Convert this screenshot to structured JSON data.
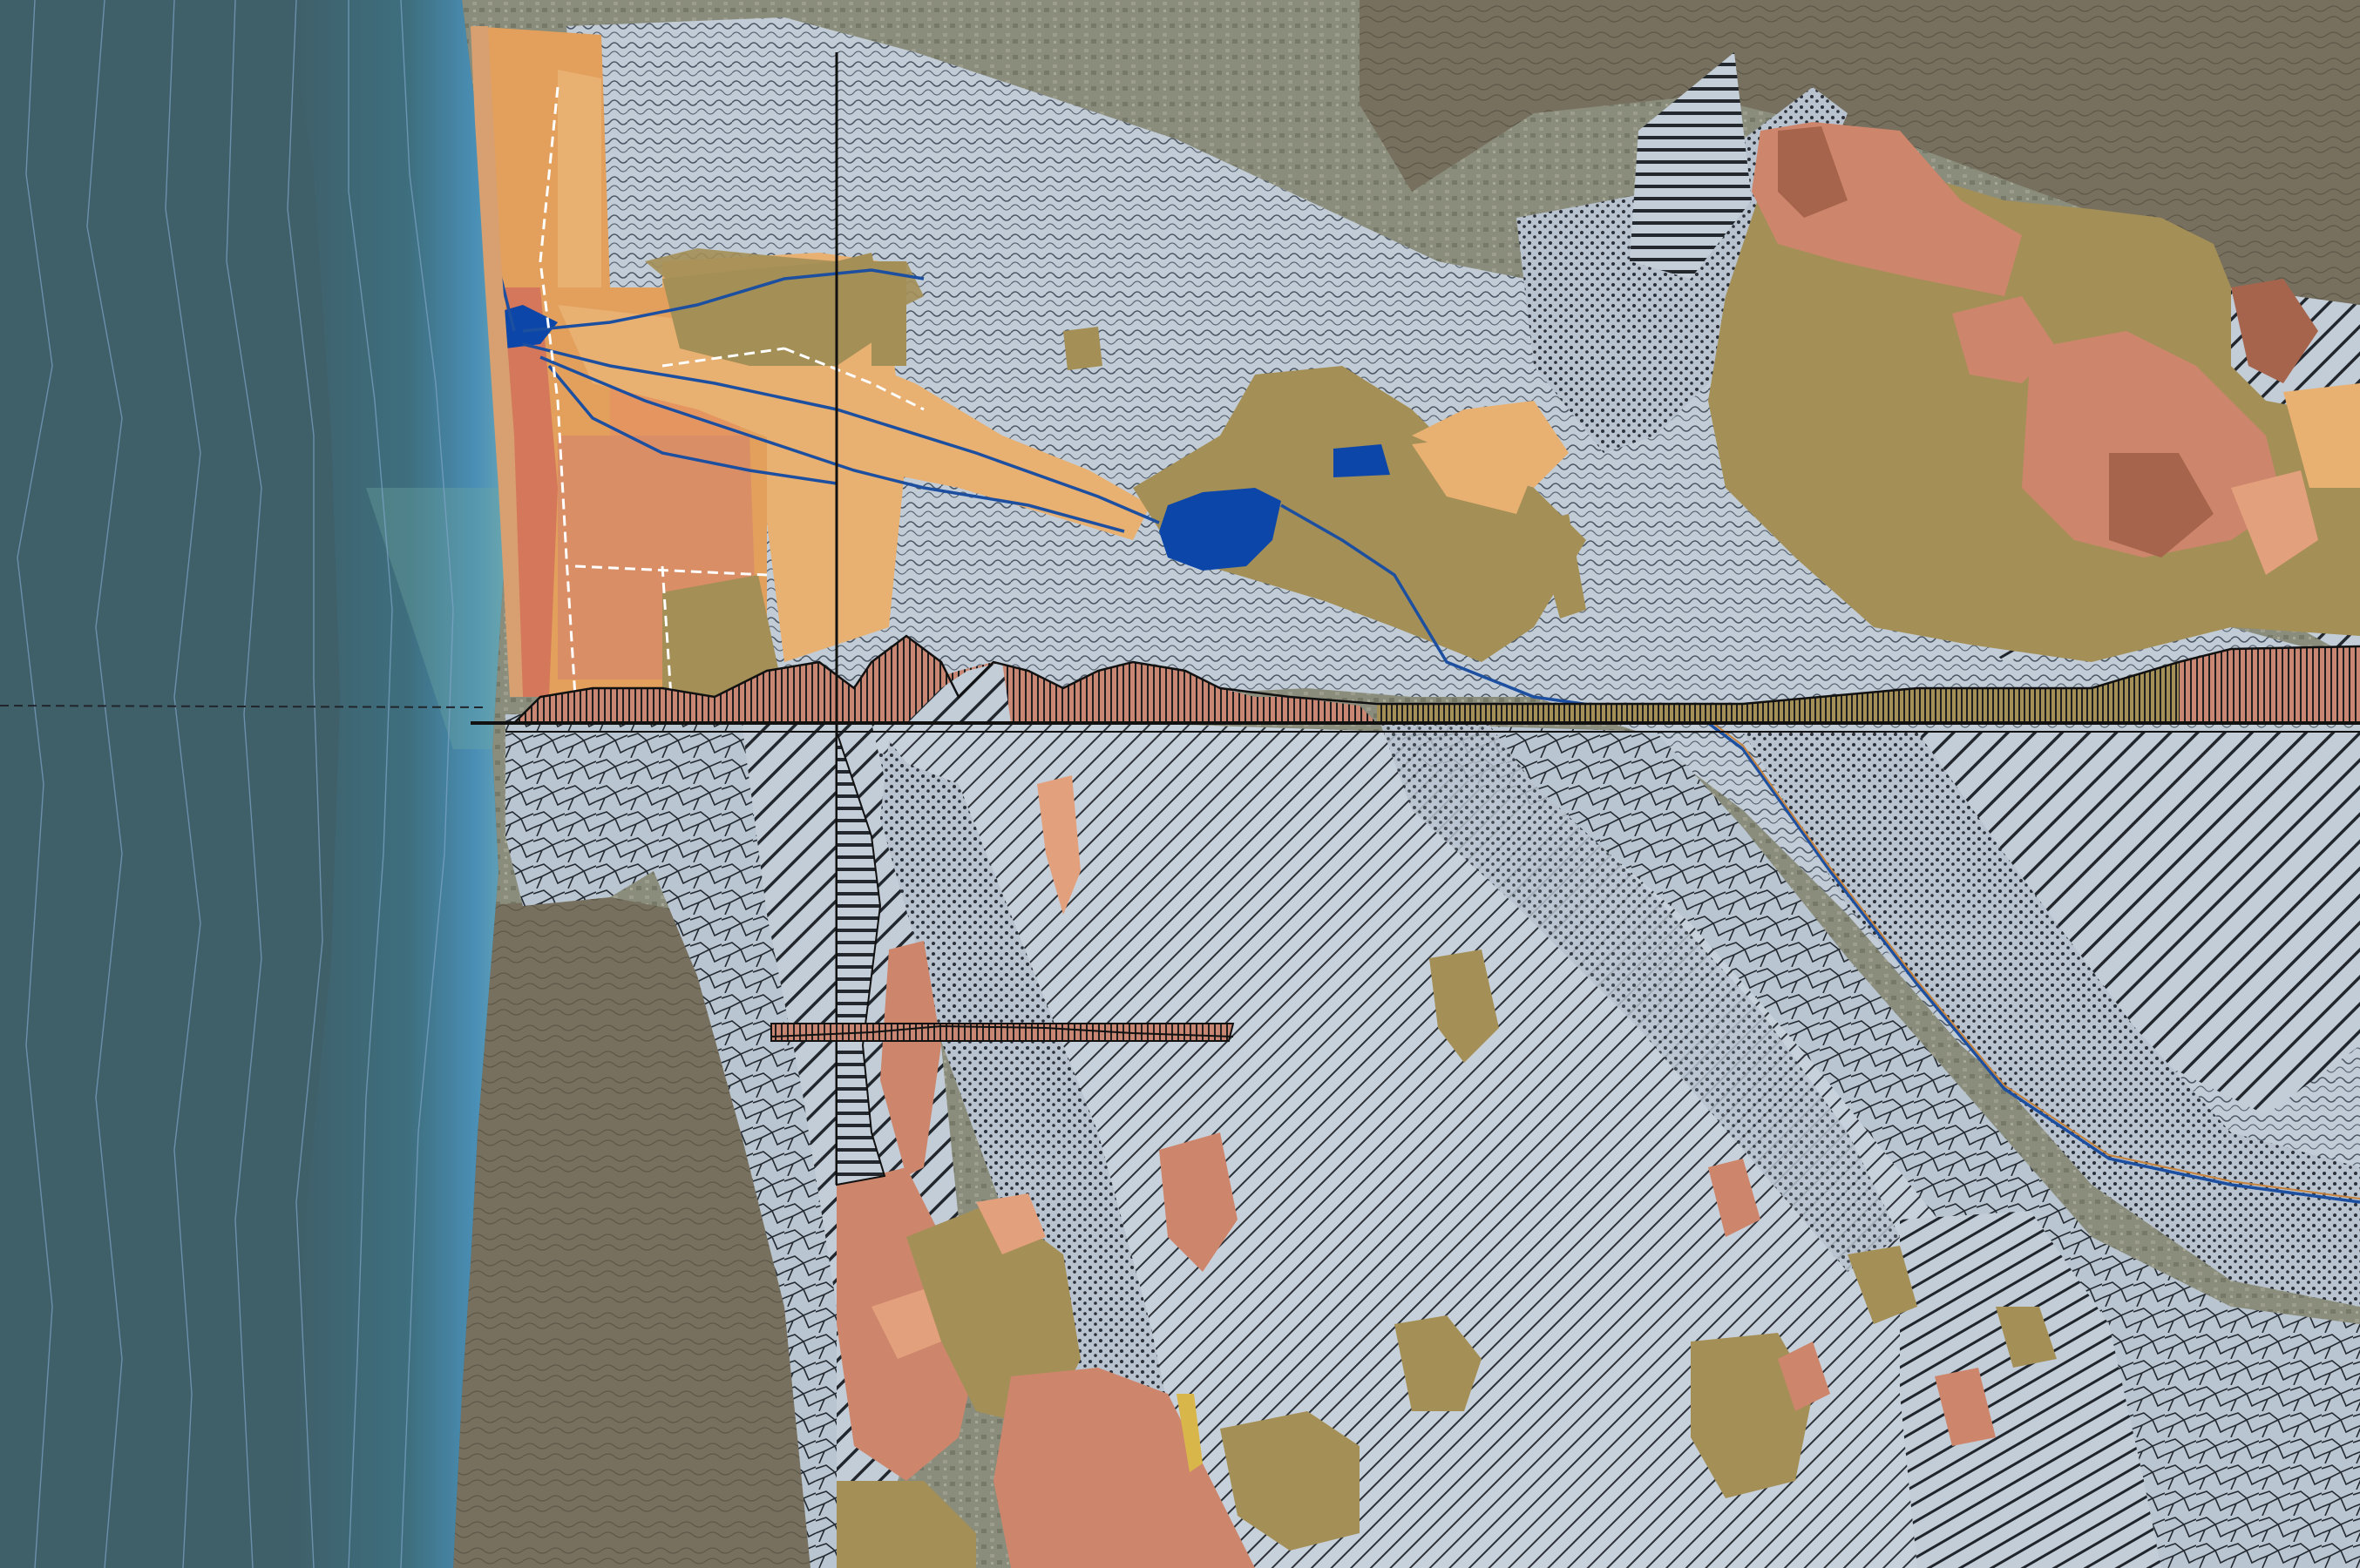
{
  "map": {
    "colors": {
      "ocean": "#3f5f69",
      "ocean_deep": "#39565f",
      "ocean_contour": "#7fa5c8",
      "surf": "#4f8fb8",
      "shore_green": "#5a8d79",
      "land_base": "#7d7f69",
      "urban": "#8a8c7a",
      "hills": "#76705f",
      "hills_dark": "#5f5a4d",
      "hatch_fill": "#bcc8d4",
      "hatch_line": "#20252c",
      "olive": "#a48f57",
      "orange": "#e2a05c",
      "tan": "#e8b071",
      "salmon": "#cd866c",
      "rust": "#a7644c",
      "peach": "#e3a07d",
      "water": "#0b46a8",
      "river": "#1d4fa0",
      "highway": "#c6843f",
      "section_line": "#111111"
    }
  }
}
